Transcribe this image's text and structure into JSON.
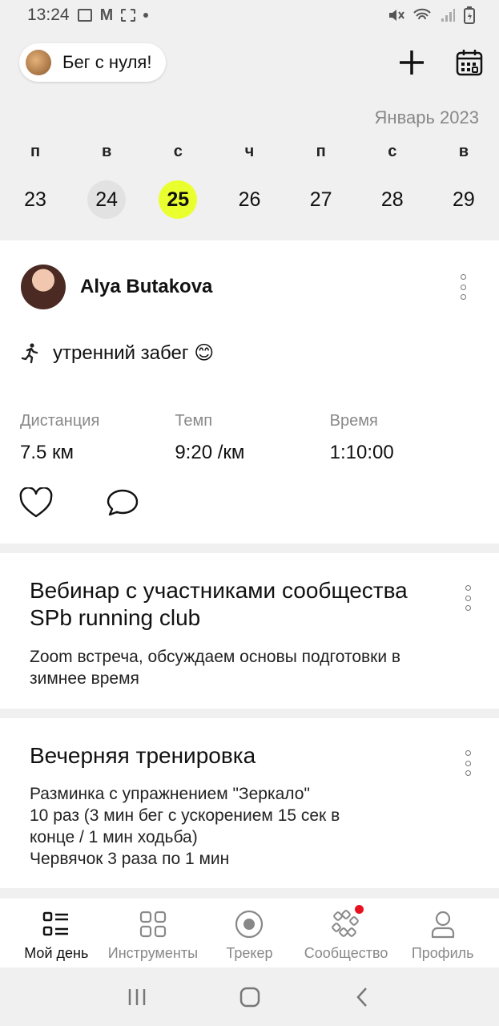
{
  "status_bar": {
    "time": "13:24"
  },
  "header": {
    "club_name": "Бег с нуля!",
    "add_icon": "plus-icon",
    "calendar_icon": "calendar-icon"
  },
  "calendar": {
    "month": "Январь 2023",
    "weekdays": [
      "п",
      "в",
      "с",
      "ч",
      "п",
      "с",
      "в"
    ],
    "days": [
      "23",
      "24",
      "25",
      "26",
      "27",
      "28",
      "29"
    ],
    "selected_day": "25",
    "accent_color": "#eaff2e"
  },
  "post": {
    "author": "Alya Butakova",
    "title": "утренний забег 😊",
    "stats": [
      {
        "label": "Дистанция",
        "value": "7.5 км"
      },
      {
        "label": "Темп",
        "value": "9:20 /км"
      },
      {
        "label": "Время",
        "value": "1:10:00"
      }
    ]
  },
  "events": [
    {
      "title": "Вебинар с участниками сообщества SPb running club",
      "description": "Zoom встреча, обсуждаем основы подготовки в зимнее время"
    },
    {
      "title": "Вечерняя тренировка",
      "description_lines": [
        "Разминка с упражнением \"Зеркало\"",
        "10 раз (3 мин бег с ускорением 15 сек в",
        "конце / 1 мин ходьба)",
        "Червячок 3 раза по 1 мин"
      ]
    }
  ],
  "bottom_nav": {
    "items": [
      {
        "label": "Мой день",
        "icon": "my-day-icon",
        "active": true
      },
      {
        "label": "Инструменты",
        "icon": "tools-icon",
        "active": false
      },
      {
        "label": "Трекер",
        "icon": "tracker-icon",
        "active": false
      },
      {
        "label": "Сообщество",
        "icon": "community-icon",
        "active": false,
        "badge": true
      },
      {
        "label": "Профиль",
        "icon": "profile-icon",
        "active": false
      }
    ],
    "badge_color": "#e8121e"
  }
}
